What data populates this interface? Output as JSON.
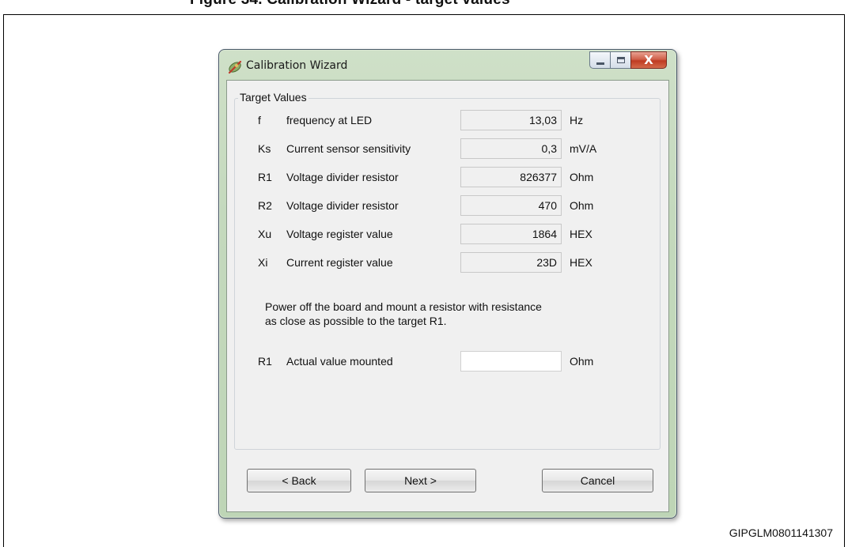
{
  "doc": {
    "heading": "Figure 34. Calibration Wizard - target values",
    "figure_id": "GIPGLM0801141307"
  },
  "window": {
    "title": "Calibration Wizard",
    "caption_buttons": {
      "minimize": "minimize",
      "maximize": "maximize",
      "close": "X"
    }
  },
  "group": {
    "title": "Target Values"
  },
  "rows": [
    {
      "symbol": "f",
      "label": "frequency at LED",
      "value": "13,03",
      "unit": "Hz"
    },
    {
      "symbol": "Ks",
      "label": "Current sensor sensitivity",
      "value": "0,3",
      "unit": "mV/A"
    },
    {
      "symbol": "R1",
      "label": "Voltage divider resistor",
      "value": "826377",
      "unit": "Ohm"
    },
    {
      "symbol": "R2",
      "label": "Voltage divider resistor",
      "value": "470",
      "unit": "Ohm"
    },
    {
      "symbol": "Xu",
      "label": "Voltage register value",
      "value": "1864",
      "unit": "HEX"
    },
    {
      "symbol": "Xi",
      "label": "Current register value",
      "value": "23D",
      "unit": "HEX"
    }
  ],
  "message": {
    "line1": "Power off the board and mount a resistor with resistance",
    "line2": "as close as possible to the target R1."
  },
  "actual": {
    "symbol": "R1",
    "label": "Actual value mounted",
    "value": "",
    "unit": "Ohm"
  },
  "buttons": {
    "back": "< Back",
    "next": "Next >",
    "cancel": "Cancel"
  }
}
